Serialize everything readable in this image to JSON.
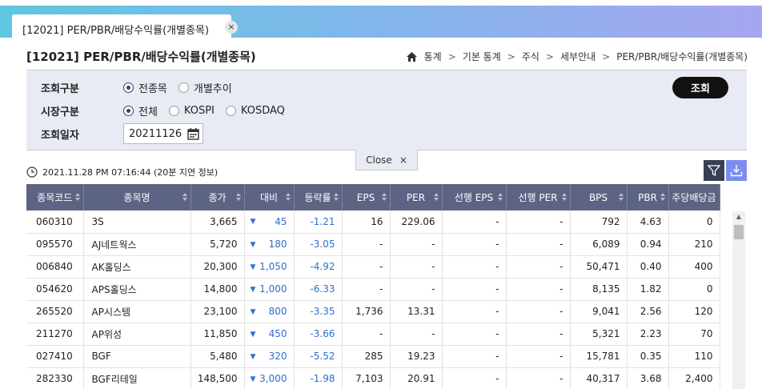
{
  "tab": {
    "label": "[12021] PER/PBR/배당수익률(개별종목)",
    "close": "×"
  },
  "page": {
    "title": "[12021] PER/PBR/배당수익률(개별종목)"
  },
  "breadcrumb": [
    "통계",
    "기본 통계",
    "주식",
    "세부안내",
    "PER/PBR/배당수익률(개별종목)"
  ],
  "filter": {
    "query_type": {
      "label": "조회구분",
      "options": [
        "전종목",
        "개별추이"
      ],
      "selected": "전종목"
    },
    "market_type": {
      "label": "시장구분",
      "options": [
        "전체",
        "KOSPI",
        "KOSDAQ"
      ],
      "selected": "전체"
    },
    "query_date": {
      "label": "조회일자",
      "value": "20211126"
    },
    "search_label": "조회"
  },
  "close_panel": {
    "label": "Close",
    "icon": "×"
  },
  "timestamp": "2021.11.28 PM 07:16:44 (20분 지연 정보)",
  "table": {
    "columns": [
      "종목코드",
      "종목명",
      "종가",
      "대비",
      "등락률",
      "EPS",
      "PER",
      "선행 EPS",
      "선행 PER",
      "BPS",
      "PBR",
      "주당배당금"
    ],
    "rows": [
      [
        "060310",
        "3S",
        "3,665",
        "45",
        "-1.21",
        "16",
        "229.06",
        "-",
        "-",
        "792",
        "4.63",
        "0"
      ],
      [
        "095570",
        "AJ네트웍스",
        "5,720",
        "180",
        "-3.05",
        "-",
        "-",
        "-",
        "-",
        "6,089",
        "0.94",
        "210"
      ],
      [
        "006840",
        "AK홀딩스",
        "20,300",
        "1,050",
        "-4.92",
        "-",
        "-",
        "-",
        "-",
        "50,471",
        "0.40",
        "400"
      ],
      [
        "054620",
        "APS홀딩스",
        "14,800",
        "1,000",
        "-6.33",
        "-",
        "-",
        "-",
        "-",
        "8,135",
        "1.82",
        "0"
      ],
      [
        "265520",
        "AP시스템",
        "23,100",
        "800",
        "-3.35",
        "1,736",
        "13.31",
        "-",
        "-",
        "9,041",
        "2.56",
        "120"
      ],
      [
        "211270",
        "AP위성",
        "11,850",
        "450",
        "-3.66",
        "-",
        "-",
        "-",
        "-",
        "5,321",
        "2.23",
        "70"
      ],
      [
        "027410",
        "BGF",
        "5,480",
        "320",
        "-5.52",
        "285",
        "19.23",
        "-",
        "-",
        "15,781",
        "0.35",
        "110"
      ],
      [
        "282330",
        "BGF리테일",
        "148,500",
        "3,000",
        "-1.98",
        "7,103",
        "20.91",
        "-",
        "-",
        "40,317",
        "3.68",
        "2,400"
      ]
    ]
  },
  "colors": {
    "header_bg": "#5d6383",
    "down": "#2e6fd0",
    "filter_bg": "#e9ebf4"
  }
}
